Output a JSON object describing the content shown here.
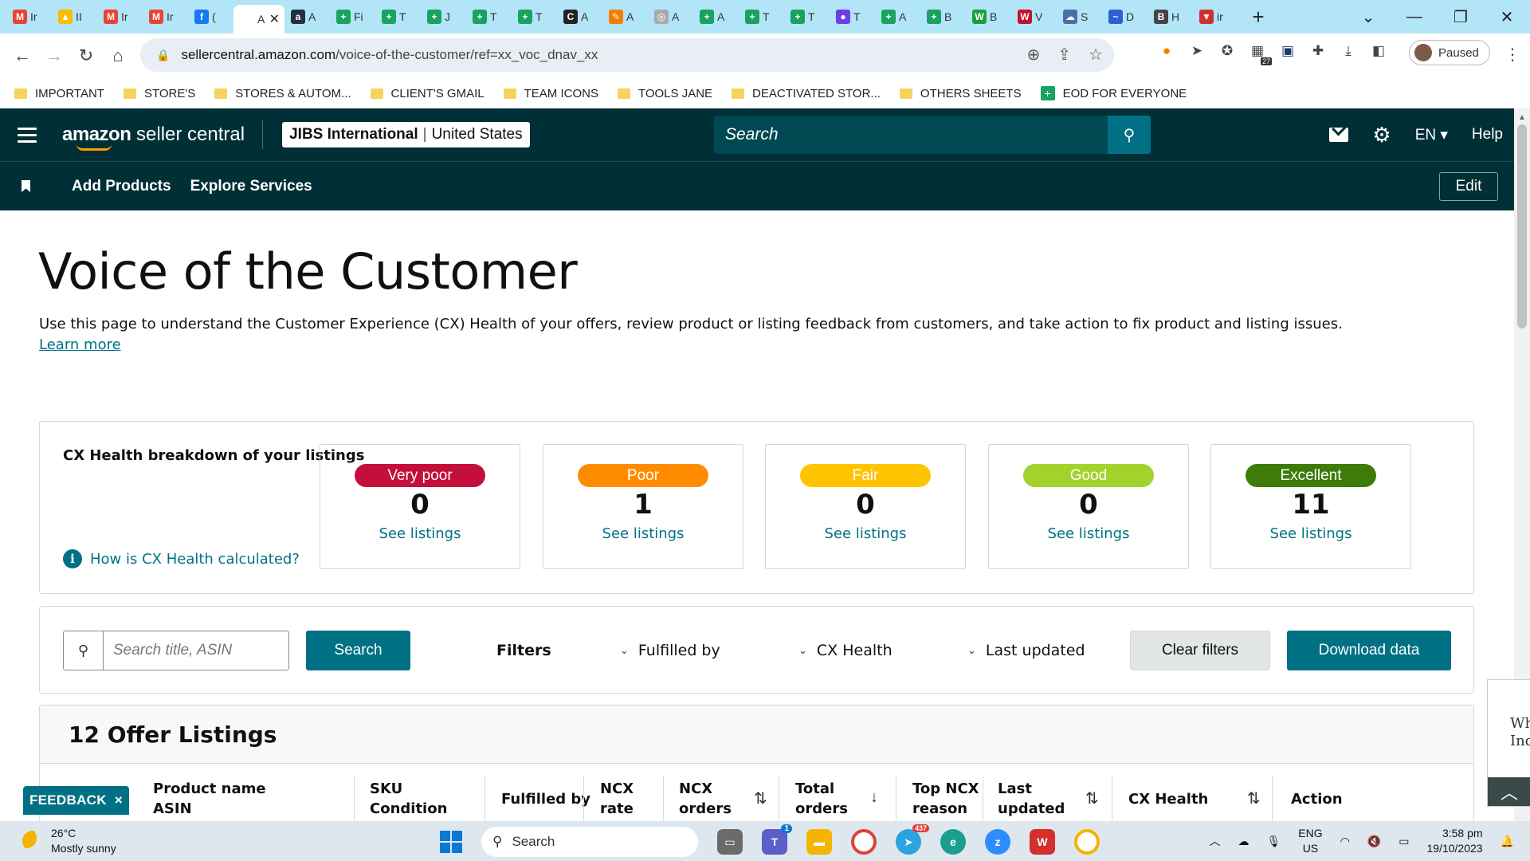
{
  "browser": {
    "tabs": [
      {
        "icon": "gmail-icon",
        "label": "Ir",
        "color": "#ea4335",
        "glyph": "M"
      },
      {
        "icon": "drive-icon",
        "label": "II",
        "color": "#fbbc04",
        "glyph": "▲"
      },
      {
        "icon": "gmail-icon",
        "label": "Ir",
        "color": "#ea4335",
        "glyph": "M"
      },
      {
        "icon": "gmail-icon",
        "label": "Ir",
        "color": "#ea4335",
        "glyph": "M"
      },
      {
        "icon": "facebook-icon",
        "label": "(",
        "color": "#1877f2",
        "glyph": "f"
      },
      {
        "icon": "amazon-icon",
        "label": "A",
        "color": "#ffffff",
        "glyph": "",
        "active": true
      },
      {
        "icon": "amazon-a-icon",
        "label": "A",
        "color": "#232f3e",
        "glyph": "a"
      },
      {
        "icon": "sheets-icon",
        "label": "Fi",
        "color": "#1aa260",
        "glyph": "+"
      },
      {
        "icon": "sheets-icon",
        "label": "T",
        "color": "#1aa260",
        "glyph": "+"
      },
      {
        "icon": "sheets-icon",
        "label": "J",
        "color": "#1aa260",
        "glyph": "+"
      },
      {
        "icon": "sheets-icon",
        "label": "T",
        "color": "#1aa260",
        "glyph": "+"
      },
      {
        "icon": "sheets-icon",
        "label": "T",
        "color": "#1aa260",
        "glyph": "+"
      },
      {
        "icon": "c-icon",
        "label": "A",
        "color": "#222222",
        "glyph": "C"
      },
      {
        "icon": "pencil-icon",
        "label": "A",
        "color": "#f57c00",
        "glyph": "✎"
      },
      {
        "icon": "globe-icon",
        "label": "A",
        "color": "#aaaaaa",
        "glyph": "◎"
      },
      {
        "icon": "sheets-icon",
        "label": "A",
        "color": "#1aa260",
        "glyph": "+"
      },
      {
        "icon": "sheets-icon",
        "label": "T",
        "color": "#1aa260",
        "glyph": "+"
      },
      {
        "icon": "sheets-icon",
        "label": "T",
        "color": "#1aa260",
        "glyph": "+"
      },
      {
        "icon": "chat-icon",
        "label": "T",
        "color": "#6a3de8",
        "glyph": "●"
      },
      {
        "icon": "sheets-icon",
        "label": "A",
        "color": "#1aa260",
        "glyph": "+"
      },
      {
        "icon": "sheets-icon",
        "label": "B",
        "color": "#1aa260",
        "glyph": "+"
      },
      {
        "icon": "w-icon",
        "label": "B",
        "color": "#1b9e3e",
        "glyph": "W"
      },
      {
        "icon": "ww-icon",
        "label": "V",
        "color": "#c8102e",
        "glyph": "W"
      },
      {
        "icon": "cloud-icon",
        "label": "S",
        "color": "#4a6fa5",
        "glyph": "☁"
      },
      {
        "icon": "wave-icon",
        "label": "D",
        "color": "#2d5fd4",
        "glyph": "~"
      },
      {
        "icon": "b-icon",
        "label": "H",
        "color": "#444444",
        "glyph": "B"
      },
      {
        "icon": "v-icon",
        "label": "ir",
        "color": "#d32f2f",
        "glyph": "▼"
      }
    ],
    "url_host": "sellercentral.amazon.com",
    "url_path": "/voice-of-the-customer/ref=xx_voc_dnav_xx",
    "profile_status": "Paused",
    "ext_badge": "27",
    "bookmarks": [
      {
        "label": "IMPORTANT",
        "type": "folder"
      },
      {
        "label": "STORE'S",
        "type": "folder"
      },
      {
        "label": "STORES & AUTOM...",
        "type": "folder"
      },
      {
        "label": "CLIENT'S GMAIL",
        "type": "folder"
      },
      {
        "label": "TEAM ICONS",
        "type": "folder"
      },
      {
        "label": "TOOLS JANE",
        "type": "folder"
      },
      {
        "label": "DEACTIVATED STOR...",
        "type": "folder"
      },
      {
        "label": "OTHERS SHEETS",
        "type": "folder"
      },
      {
        "label": "EOD FOR EVERYONE",
        "type": "sheet"
      }
    ]
  },
  "header": {
    "logo_bold": "amazon",
    "logo_rest": " seller central",
    "store_name": "JIBS International",
    "store_region": "United States",
    "search_placeholder": "Search",
    "language": "EN",
    "help": "Help"
  },
  "subnav": {
    "items": [
      "Add Products",
      "Explore Services"
    ],
    "edit": "Edit"
  },
  "page": {
    "title": "Voice of the Customer",
    "description": "Use this page to understand the Customer Experience (CX) Health of your offers, review product or listing feedback from customers, and take action to fix product and listing issues.",
    "learn_more": "Learn more"
  },
  "cx": {
    "title": "CX Health breakdown of your listings",
    "how_link": "How is CX Health calculated?",
    "info_glyph": "i",
    "cards": [
      {
        "label": "Very poor",
        "count": "0",
        "link": "See listings",
        "color": "#c40f3a"
      },
      {
        "label": "Poor",
        "count": "1",
        "link": "See listings",
        "color": "#ff8c00"
      },
      {
        "label": "Fair",
        "count": "0",
        "link": "See listings",
        "color": "#ffc400"
      },
      {
        "label": "Good",
        "count": "0",
        "link": "See listings",
        "color": "#a2d22c"
      },
      {
        "label": "Excellent",
        "count": "11",
        "link": "See listings",
        "color": "#3d7c0a"
      }
    ]
  },
  "filters": {
    "search_placeholder": "Search title, ASIN",
    "search_button": "Search",
    "label": "Filters",
    "fulfilled_by": "Fulfilled by",
    "cx_health": "CX Health",
    "last_updated": "Last updated",
    "clear": "Clear filters",
    "download": "Download data"
  },
  "listings": {
    "heading": "12 Offer Listings",
    "columns": {
      "product_name": "Product name",
      "asin": "ASIN",
      "sku": "SKU",
      "condition": "Condition",
      "fulfilled_by": "Fulfilled by",
      "ncx_rate_1": "NCX",
      "ncx_rate_2": "rate",
      "ncx_orders_1": "NCX",
      "ncx_orders_2": "orders",
      "total_orders_1": "Total",
      "total_orders_2": "orders",
      "top_ncx_1": "Top NCX",
      "top_ncx_2": "reason",
      "last_updated_1": "Last",
      "last_updated_2": "updated",
      "cx_health": "CX Health",
      "action": "Action"
    }
  },
  "feedback": {
    "label": "FEEDBACK",
    "close": "×"
  },
  "side_widget": {
    "text_1": "Wh",
    "text_2": "Inq"
  },
  "taskbar": {
    "temperature": "26°C",
    "weather": "Mostly sunny",
    "search": "Search",
    "telegram_badge": "437",
    "teams_badge": "1",
    "lang_1": "ENG",
    "lang_2": "US",
    "time": "3:58 pm",
    "date": "19/10/2023"
  }
}
